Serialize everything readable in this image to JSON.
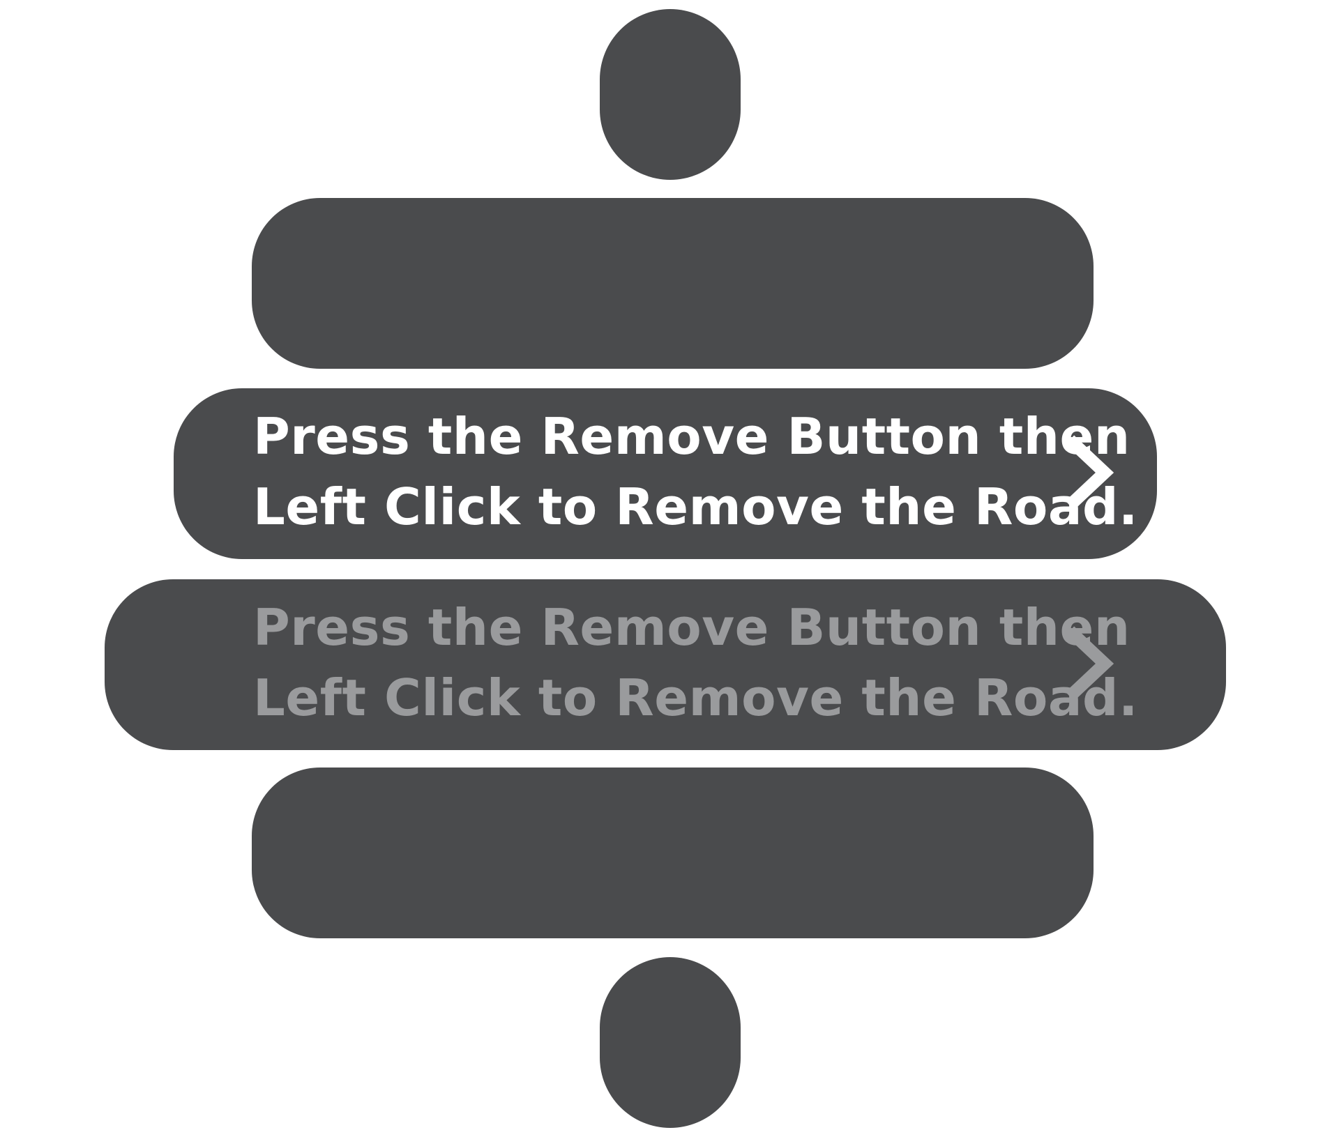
{
  "colors": {
    "background": "#ffffff",
    "panel": "#4a4b4d",
    "text_active": "#ffffff",
    "text_dim": "#9a9b9d"
  },
  "tooltip_active": {
    "line1": "Press the Remove Button then",
    "line2": "Left Click to Remove the Road.",
    "icon": "chevron-right-icon"
  },
  "tooltip_dim": {
    "line1": "Press the Remove Button then",
    "line2": "Left Click to Remove the Road.",
    "icon": "chevron-right-icon"
  }
}
